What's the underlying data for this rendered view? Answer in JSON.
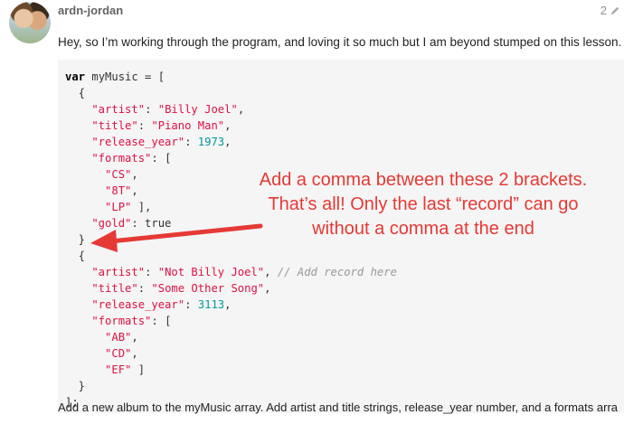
{
  "post": {
    "username": "ardn-jordan",
    "edit_count": "2",
    "intro": "Hey, so I’m working through the program, and loving it so much but I am beyond stumped on this lesson.",
    "footer": "Add a new album to the myMusic array. Add artist and title strings, release_year number, and a formats arra"
  },
  "code": {
    "l1a": "var",
    "l1b": " myMusic = [",
    "l2": "  {",
    "l3k": "    \"artist\"",
    "l3s": ": ",
    "l3v": "\"Billy Joel\"",
    "l3e": ",",
    "l4k": "    \"title\"",
    "l4s": ": ",
    "l4v": "\"Piano Man\"",
    "l4e": ",",
    "l5k": "    \"release_year\"",
    "l5s": ": ",
    "l5v": "1973",
    "l5e": ",",
    "l6k": "    \"formats\"",
    "l6s": ": [",
    "l7v": "      \"CS\"",
    "l7e": ",",
    "l8v": "      \"8T\"",
    "l8e": ",",
    "l9v": "      \"LP\"",
    "l9e": " ],",
    "l10k": "    \"gold\"",
    "l10s": ": true",
    "l11": "  }",
    "l12": "  {",
    "l13k": "    \"artist\"",
    "l13s": ": ",
    "l13v": "\"Not Billy Joel\"",
    "l13e": ", ",
    "l13c": "// Add record here",
    "l14k": "    \"title\"",
    "l14s": ": ",
    "l14v": "\"Some Other Song\"",
    "l14e": ",",
    "l15k": "    \"release_year\"",
    "l15s": ": ",
    "l15v": "3113",
    "l15e": ",",
    "l16k": "    \"formats\"",
    "l16s": ": [",
    "l17v": "      \"AB\"",
    "l17e": ",",
    "l18v": "      \"CD\"",
    "l18e": ",",
    "l19v": "      \"EF\"",
    "l19e": " ]",
    "l20": "  }",
    "l21": "];"
  },
  "annotation": {
    "line1": "Add a comma between these 2 brackets.",
    "line2": "That’s all! Only the last “record” can go",
    "line3": "without a comma at the end",
    "color": "#e53935"
  }
}
